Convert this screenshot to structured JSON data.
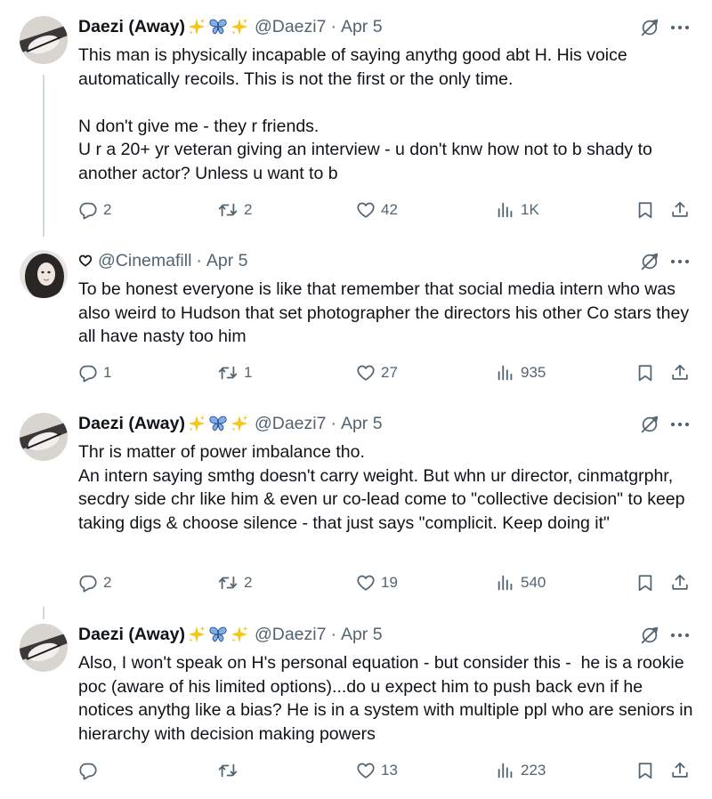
{
  "tweets": [
    {
      "name": "Daezi (Away)",
      "handle": "@Daezi7",
      "date": "Apr 5",
      "sep": "·",
      "text": "This man is physically incapable of saying anythg good abt H. His voice automatically recoils. This is not the first or the only time.\n\nN don't give me - they r friends.\nU r a 20+ yr veteran giving an interview - u don't knw how not to b shady to another actor? Unless u want to b",
      "replies": "2",
      "retweets": "2",
      "likes": "42",
      "views": "1K"
    },
    {
      "name": "",
      "handle": "@Cinemafill",
      "date": "Apr 5",
      "sep": "·",
      "text": "To be honest everyone is like that remember that social media intern who was also weird to Hudson that set photographer the directors his other Co stars they all have nasty too him",
      "replies": "1",
      "retweets": "1",
      "likes": "27",
      "views": "935"
    },
    {
      "name": "Daezi (Away)",
      "handle": "@Daezi7",
      "date": "Apr 5",
      "sep": "·",
      "text": "Thr is matter of power imbalance tho.\nAn intern saying smthg doesn't carry weight. But whn ur director, cinmatgrphr, secdry side chr like him & even ur co-lead come to \"collective decision\" to keep taking digs & choose silence - that just says \"complicit. Keep doing it\"",
      "replies": "2",
      "retweets": "2",
      "likes": "19",
      "views": "540"
    },
    {
      "name": "Daezi (Away)",
      "handle": "@Daezi7",
      "date": "Apr 5",
      "sep": "·",
      "text": "Also, I won't speak on H's personal equation - but consider this -  he is a rookie poc (aware of his limited options)...do u expect him to push back evn if he notices anythg like a bias? He is in a system with multiple ppl who are seniors in hierarchy with decision making powers",
      "replies": "",
      "retweets": "",
      "likes": "13",
      "views": "223"
    }
  ],
  "icons": {
    "sparkle": "sparkles-icon",
    "butterfly": "butterfly-icon",
    "grok": "grok-icon",
    "more": "more-icon",
    "reply": "reply-icon",
    "retweet": "retweet-icon",
    "like": "heart-icon",
    "views": "views-icon",
    "bookmark": "bookmark-icon",
    "share": "share-icon"
  },
  "colors": {
    "text": "#0f1419",
    "secondary": "#536471",
    "thread": "#cfd9de",
    "sparkle": "#f5c518",
    "butterfly": "#5b8fd6"
  }
}
